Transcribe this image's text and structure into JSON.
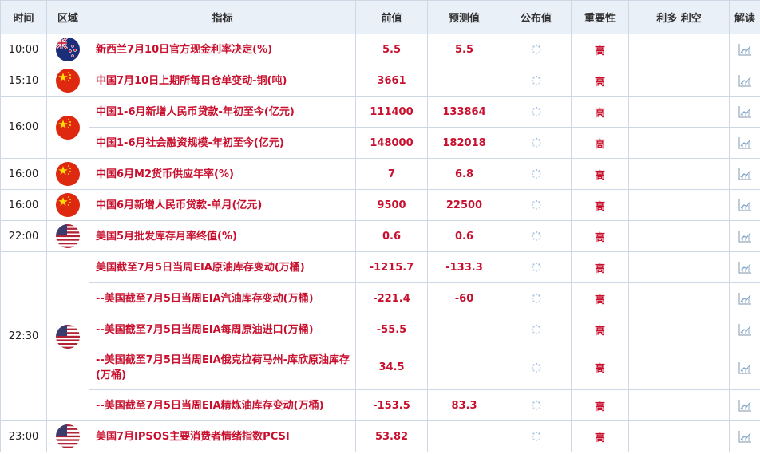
{
  "headers": {
    "time": "时间",
    "region": "区域",
    "indicator": "指标",
    "prev": "前值",
    "forecast": "预测值",
    "actual": "公布值",
    "importance": "重要性",
    "bull_bear": "利多 利空",
    "analysis": "解读"
  },
  "colors": {
    "accent_red": "#c8102e",
    "header_bg": "#eaf0f8",
    "border": "#cfd9e6"
  },
  "rows": [
    {
      "time": "10:00",
      "flag": "nz",
      "indicator": "新西兰7月10日官方现金利率决定(%)",
      "prev": "5.5",
      "forecast": "5.5",
      "importance": "高"
    },
    {
      "time": "15:10",
      "flag": "cn",
      "indicator": "中国7月10日上期所每日仓单变动-铜(吨)",
      "prev": "3661",
      "forecast": "",
      "importance": "高"
    },
    {
      "time": "16:00",
      "flag": "cn",
      "indicator": "中国1-6月新增人民币贷款-年初至今(亿元)",
      "prev": "111400",
      "forecast": "133864",
      "importance": "高"
    },
    {
      "time": "",
      "flag": "",
      "indicator": "中国1-6月社会融资规模-年初至今(亿元)",
      "prev": "148000",
      "forecast": "182018",
      "importance": "高"
    },
    {
      "time": "16:00",
      "flag": "cn",
      "indicator": "中国6月M2货币供应年率(%)",
      "prev": "7",
      "forecast": "6.8",
      "importance": "高"
    },
    {
      "time": "16:00",
      "flag": "cn",
      "indicator": "中国6月新增人民币贷款-单月(亿元)",
      "prev": "9500",
      "forecast": "22500",
      "importance": "高"
    },
    {
      "time": "22:00",
      "flag": "us",
      "indicator": "美国5月批发库存月率终值(%)",
      "prev": "0.6",
      "forecast": "0.6",
      "importance": "高"
    },
    {
      "time": "22:30",
      "flag": "us",
      "indicator": "美国截至7月5日当周EIA原油库存变动(万桶)",
      "prev": "-1215.7",
      "forecast": "-133.3",
      "importance": "高"
    },
    {
      "time": "",
      "flag": "",
      "indicator": "--美国截至7月5日当周EIA汽油库存变动(万桶)",
      "prev": "-221.4",
      "forecast": "-60",
      "importance": "高"
    },
    {
      "time": "",
      "flag": "",
      "indicator": "--美国截至7月5日当周EIA每周原油进口(万桶)",
      "prev": "-55.5",
      "forecast": "",
      "importance": "高"
    },
    {
      "time": "",
      "flag": "",
      "indicator": "--美国截至7月5日当周EIA俄克拉荷马州-库欣原油库存(万桶)",
      "prev": "34.5",
      "forecast": "",
      "importance": "高"
    },
    {
      "time": "",
      "flag": "",
      "indicator": "--美国截至7月5日当周EIA精炼油库存变动(万桶)",
      "prev": "-153.5",
      "forecast": "83.3",
      "importance": "高"
    },
    {
      "time": "23:00",
      "flag": "us",
      "indicator": "美国7月IPSOS主要消费者情绪指数PCSI",
      "prev": "53.82",
      "forecast": "",
      "importance": "高"
    }
  ]
}
